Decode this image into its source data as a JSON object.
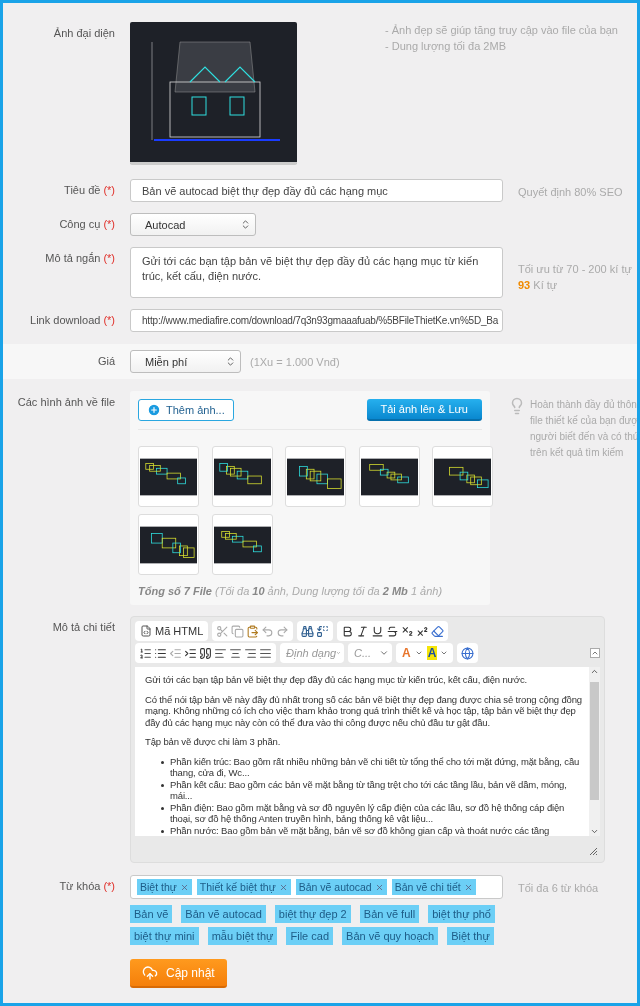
{
  "avatar": {
    "label": "Ảnh đại diện",
    "hints": [
      "- Ảnh đẹp sẽ giúp tăng truy cập vào file của bạn",
      "- Dung lượng tối đa 2MB"
    ]
  },
  "title": {
    "label": "Tiêu đề",
    "required": "(*)",
    "value": "Bản vẽ autocad biệt thự đẹp đầy đủ các hạng mục",
    "hint": "Quyết định 80% SEO"
  },
  "tool": {
    "label": "Công cụ",
    "required": "(*)",
    "value": "Autocad"
  },
  "short_description": {
    "label": "Mô tả ngắn",
    "required": "(*)",
    "value": "Gửi tới các bạn tập bản vẽ biệt thự đẹp đầy đủ các hạng mục từ kiến trúc, kết cấu, điện nước.",
    "hint": "Tối ưu từ 70 - 200 kí tự",
    "count": "93",
    "count_unit": "Kí tự"
  },
  "link": {
    "label": "Link download",
    "required": "(*)",
    "value": "http://www.mediafire.com/download/7q3n93gmaaafuab/%5BFileThietKe.vn%5D_Ba"
  },
  "price": {
    "label": "Giá",
    "value": "Miễn phí",
    "note": "(1Xu = 1.000 Vnđ)"
  },
  "images": {
    "label": "Các hình ảnh về file",
    "add_button": "Thêm ảnh...",
    "upload_button": "Tải ảnh lên & Lưu",
    "summary": "**Tổng số 7 File** (Tối đa **10** ảnh, Dung lượng tối đa **2 Mb** 1 ảnh)",
    "hint_lines": [
      "Hoàn thành đầy đủ thôn",
      "file thiết kế của bạn đượ",
      "người biết đến và có thú",
      "trên kết quả tìm kiếm"
    ]
  },
  "details": {
    "label": "Mô tả chi tiết",
    "html_button": "Mã HTML",
    "format_select": "Định dạng",
    "font_select": "C...",
    "text_color": "A",
    "background_color": "A",
    "paragraphs": [
      "Gửi tới các bạn tập bản vẽ biệt thự đẹp đầy đủ các hạng mục từ kiến trúc, kết cấu, điện nước.",
      "Có thể nói tập bản vẽ này đầy đủ nhất trong số các bản vẽ biệt thự đẹp đang được chia sẻ trong cộng đồng mạng. Không những có ích cho việc tham khảo trong quá trình thiết kế và học tập, tập bản vẽ biệt thự đẹp đầy đủ các hạng mục này còn có thể đưa vào thi công được nếu chủ đầu tư gật đầu.",
      "Tập bản vẽ được chi làm 3 phần."
    ],
    "bullets": [
      "Phần kiến trúc: Bao gồm rất nhiều những bản vẽ chi tiết từ tổng thể cho tới mặt đứng, mặt bằng, cầu thang, cửa đi, Wc...",
      "Phần kết cấu:  Bao gồm các bản vẽ mặt bằng từ tầng trệt cho tới các tầng lầu, bản vẽ dầm, móng, mái...",
      "Phần điện: Bao gồm mặt bằng và sơ đồ nguyên lý cấp điện của các lầu, sơ đồ hệ thống cáp điện thoại, sơ đồ hệ thống Anten truyền hình, bảng thống kê vật liệu...",
      "Phần nước: Bao gồm bản vẽ mặt bằng, bản vẽ sơ đồ không gian cấp và thoát nước các tầng"
    ]
  },
  "keywords": {
    "label": "Từ khóa",
    "required": "(*)",
    "tags": [
      "Biệt thự",
      "Thiết kế biệt thự",
      "Bản vẽ autocad",
      "Bản vẽ chi tiết"
    ],
    "hint": "Tối đa 6 từ khóa",
    "suggestions": [
      "Bản vẽ",
      "Bản vẽ autocad",
      "biệt thự đẹp 2",
      "Bản vẽ full",
      "biệt thự phố",
      "biệt thự mini",
      "mẫu biệt thự",
      "File cad",
      "Bản vẽ quy hoạch",
      "Biệt thự"
    ]
  },
  "submit_button": "Cập nhật"
}
